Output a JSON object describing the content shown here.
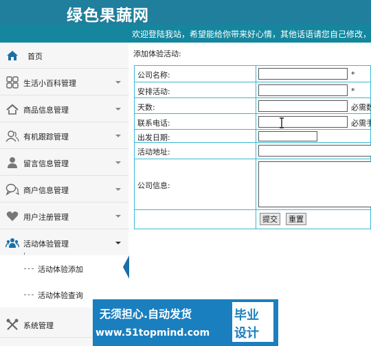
{
  "header": {
    "site_title": "绿色果蔬网",
    "marquee": "欢迎登陆我站，希望能给你带来好心情，其他话语请您自己修改，"
  },
  "sidebar": {
    "items": [
      {
        "label": "首页",
        "icon": "home-icon"
      },
      {
        "label": "生活小百科管理",
        "icon": "grid-icon"
      },
      {
        "label": "商品信息管理",
        "icon": "house-icon"
      },
      {
        "label": "有机跟踪管理",
        "icon": "users-icon"
      },
      {
        "label": "留言信息管理",
        "icon": "user-icon"
      },
      {
        "label": "商户信息管理",
        "icon": "chat-icon"
      },
      {
        "label": "用户注册管理",
        "icon": "heart-icon"
      },
      {
        "label": "活动体验管理",
        "icon": "group-icon"
      },
      {
        "label": "系统管理",
        "icon": "tools-icon"
      }
    ],
    "sub_items": [
      {
        "label": "活动体验添加"
      },
      {
        "label": "活动体验查询"
      }
    ]
  },
  "main": {
    "title": "添加体验活动:",
    "fields": {
      "company": {
        "label": "公司名称:",
        "value": "",
        "star": "*"
      },
      "activity": {
        "label": "安排活动:",
        "value": "",
        "star": "*"
      },
      "days": {
        "label": "天数:",
        "value": "",
        "hint": "必需数"
      },
      "phone": {
        "label": "联系电话:",
        "value": "",
        "hint": "必需手"
      },
      "date": {
        "label": "出发日期:",
        "value": ""
      },
      "address": {
        "label": "活动地址:",
        "value": ""
      },
      "info": {
        "label": "公司信息:",
        "value": ""
      }
    },
    "buttons": {
      "submit": "提交",
      "reset": "重置"
    }
  },
  "watermark": {
    "line1": "无须担心.自动发货",
    "line2": "www.51topmind.com",
    "right1": "毕业",
    "right2": "设计"
  },
  "colors": {
    "header_bg": "#1f7f9c",
    "table_border": "#35b9d3",
    "icon_color": "#666666",
    "active_icon_color": "#1a6fa8"
  }
}
